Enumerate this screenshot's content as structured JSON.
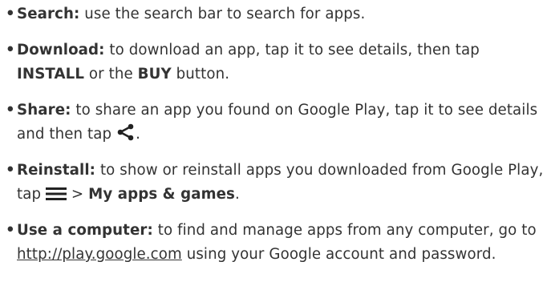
{
  "bullet": "•",
  "items": [
    {
      "label": "Search:",
      "text": " use the search bar to search for apps."
    },
    {
      "label": "Download:",
      "text1": " to download an app, tap it to see details, then tap ",
      "install": "INSTALL",
      "text2": " or the ",
      "buy": "BUY",
      "text3": " button."
    },
    {
      "label": "Share:",
      "text1": " to share an app you found on Google Play, tap it to see details and then tap ",
      "icon": "share-icon",
      "text2": "."
    },
    {
      "label": "Reinstall:",
      "text1": " to show or reinstall apps you downloaded from Google Play, tap ",
      "icon": "menu-icon",
      "text2": " > ",
      "target": "My apps & games",
      "text3": "."
    },
    {
      "label": "Use a computer:",
      "text1": " to find and manage apps from any computer, go to ",
      "link": "http://play.google.com",
      "text2": " using your Google account and password."
    }
  ],
  "colors": {
    "text": "#333333",
    "background": "#ffffff"
  }
}
